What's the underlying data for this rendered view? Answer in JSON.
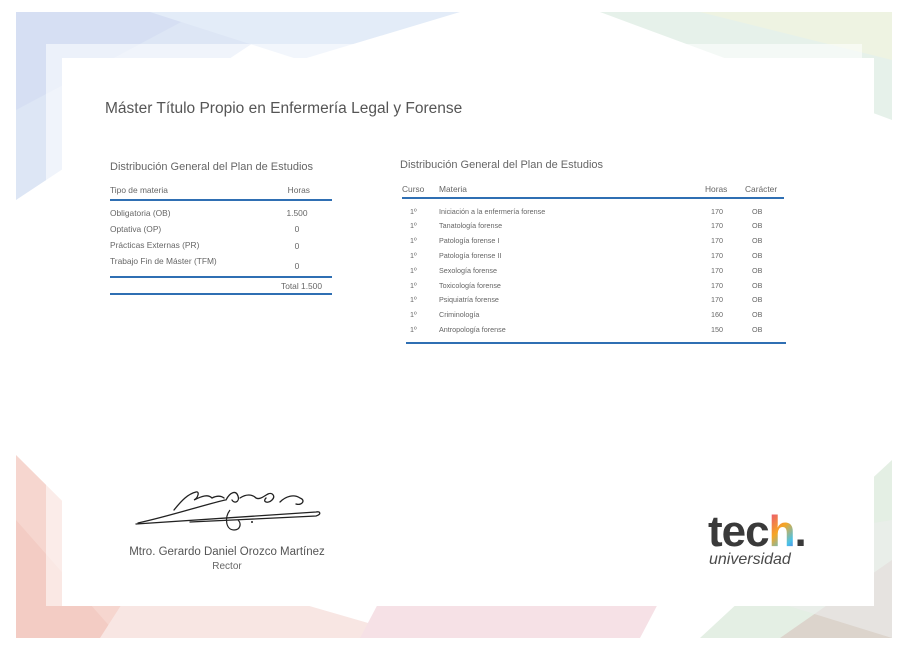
{
  "document": {
    "title": "Máster Título Propio en Enfermería Legal y Forense"
  },
  "summary_table": {
    "heading": "Distribución General del Plan de Estudios",
    "columns": [
      "Tipo de materia",
      "Horas"
    ],
    "rows": [
      {
        "type": "Obligatoria (OB)",
        "hours": "1.500"
      },
      {
        "type": "Optativa (OP)",
        "hours": "0"
      },
      {
        "type": "Prácticas Externas (PR)",
        "hours": "0"
      },
      {
        "type": "Trabajo Fin de Máster (TFM)",
        "hours": "0"
      }
    ],
    "total": "Total 1.500"
  },
  "subjects_table": {
    "heading": "Distribución General del Plan de Estudios",
    "columns": [
      "Curso",
      "Materia",
      "Horas",
      "Carácter"
    ],
    "rows": [
      {
        "course": "1º",
        "subject": "Iniciación a la enfermería forense",
        "hours": "170",
        "type": "OB"
      },
      {
        "course": "1º",
        "subject": "Tanatología forense",
        "hours": "170",
        "type": "OB"
      },
      {
        "course": "1º",
        "subject": "Patología forense I",
        "hours": "170",
        "type": "OB"
      },
      {
        "course": "1º",
        "subject": "Patología forense II",
        "hours": "170",
        "type": "OB"
      },
      {
        "course": "1º",
        "subject": "Sexología forense",
        "hours": "170",
        "type": "OB"
      },
      {
        "course": "1º",
        "subject": "Toxicología forense",
        "hours": "170",
        "type": "OB"
      },
      {
        "course": "1º",
        "subject": "Psiquiatría forense",
        "hours": "170",
        "type": "OB"
      },
      {
        "course": "1º",
        "subject": "Criminología",
        "hours": "160",
        "type": "OB"
      },
      {
        "course": "1º",
        "subject": "Antropología forense",
        "hours": "150",
        "type": "OB"
      }
    ]
  },
  "signature": {
    "name": "Mtro. Gerardo Daniel Orozco Martínez",
    "role": "Rector"
  },
  "brand": {
    "wordmark_prefix": "tec",
    "wordmark_letter": "h",
    "wordmark_dot": ".",
    "tagline": "universidad"
  },
  "colors": {
    "accent_line": "#2f6fb3",
    "text": "#555555"
  }
}
